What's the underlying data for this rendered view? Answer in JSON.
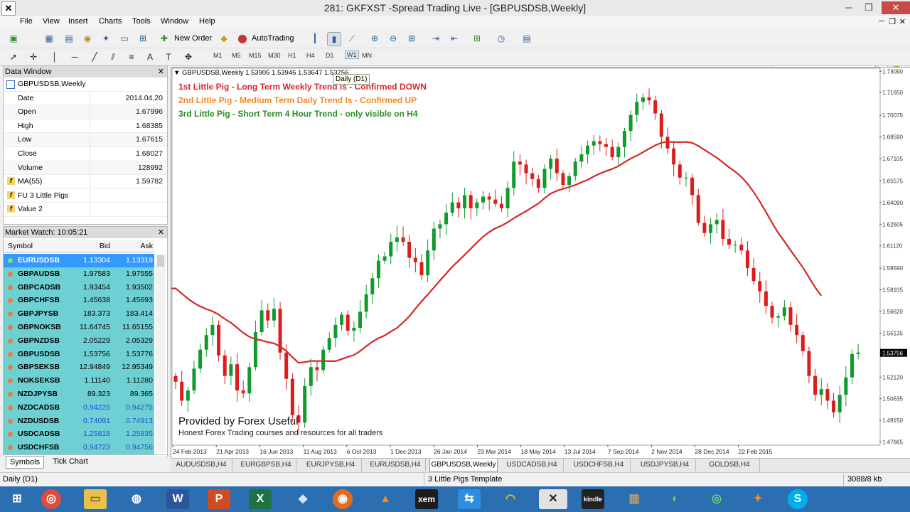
{
  "window": {
    "title": "281: GKFXST -Spread Trading Live - [GBPUSDSB,Weekly]"
  },
  "menu": [
    "File",
    "View",
    "Insert",
    "Charts",
    "Tools",
    "Window",
    "Help"
  ],
  "toolbar": {
    "new_order": "New Order",
    "autotrading": "AutoTrading"
  },
  "timeframes": [
    "M1",
    "M5",
    "M15",
    "M30",
    "H1",
    "H4",
    "D1",
    "W1",
    "MN"
  ],
  "tooltip": "Daily (D1)",
  "data_window": {
    "title": "Data Window",
    "symbol": "GBPUSDSB,Weekly",
    "rows": [
      {
        "label": "Date",
        "value": "2014.04.20"
      },
      {
        "label": "Open",
        "value": "1.67996"
      },
      {
        "label": "High",
        "value": "1.68385"
      },
      {
        "label": "Low",
        "value": "1.67615"
      },
      {
        "label": "Close",
        "value": "1.68027"
      },
      {
        "label": "Volume",
        "value": "128992"
      },
      {
        "label": "MA(55)",
        "value": "1.59782"
      },
      {
        "label": "FU 3 Little Pigs",
        "value": ""
      },
      {
        "label": "Value 2",
        "value": ""
      }
    ]
  },
  "market_watch": {
    "title": "Market Watch: 10:05:21",
    "headers": {
      "symbol": "Symbol",
      "bid": "Bid",
      "ask": "Ask"
    },
    "rows": [
      {
        "symbol": "EURUSDSB",
        "bid": "1.13304",
        "ask": "1.13319"
      },
      {
        "symbol": "GBPAUDSB",
        "bid": "1.97583",
        "ask": "1.97555"
      },
      {
        "symbol": "GBPCADSB",
        "bid": "1.93454",
        "ask": "1.93502"
      },
      {
        "symbol": "GBPCHFSB",
        "bid": "1.45638",
        "ask": "1.45693"
      },
      {
        "symbol": "GBPJPYSB",
        "bid": "183.373",
        "ask": "183.414"
      },
      {
        "symbol": "GBPNOKSB",
        "bid": "11.64745",
        "ask": "11.65155"
      },
      {
        "symbol": "GBPNZDSB",
        "bid": "2.05229",
        "ask": "2.05329"
      },
      {
        "symbol": "GBPUSDSB",
        "bid": "1.53756",
        "ask": "1.53776"
      },
      {
        "symbol": "GBPSEKSB",
        "bid": "12.94849",
        "ask": "12.95349"
      },
      {
        "symbol": "NOKSEKSB",
        "bid": "1.11140",
        "ask": "1.11280"
      },
      {
        "symbol": "NZDJPYSB",
        "bid": "89.323",
        "ask": "89.365"
      },
      {
        "symbol": "NZDCADSB",
        "bid": "0.94225",
        "ask": "0.94275"
      },
      {
        "symbol": "NZDUSDSB",
        "bid": "0.74091",
        "ask": "0.74913"
      },
      {
        "symbol": "USDCADSB",
        "bid": "1.25818",
        "ask": "1.25835"
      },
      {
        "symbol": "USDCHFSB",
        "bid": "0.94723",
        "ask": "0.94756"
      }
    ],
    "tabs": [
      "Symbols",
      "Tick Chart"
    ]
  },
  "chart": {
    "header": "GBPUSDSB,Weekly  1.53905 1.53946 1.53647 1.53756",
    "trend_lines": [
      {
        "text": "1st Little Pig - Long Term Weekly Trend is - Confirmed DOWN",
        "color": "#d9262b"
      },
      {
        "text": "2nd Little Pig - Medium Term Daily Trend Is - Confirmed UP",
        "color": "#f08a24"
      },
      {
        "text": "3rd Little Pig - Short Term 4 Hour Trend - only visible on H4",
        "color": "#2e8b2e"
      }
    ],
    "watermark": "Provided by Forex Useful",
    "subtitle": "Honest Forex Trading courses and resources for all traders",
    "current_price": "1.53756",
    "colors": {
      "bull": "#119b2d",
      "bear": "#dd1c1c",
      "ma": "#d42828"
    }
  },
  "chart_data": {
    "type": "candlestick",
    "x_labels": [
      "24 Feb 2013",
      "21 Apr 2013",
      "16 Jun 2013",
      "11 Aug 2013",
      "6 Oct 2013",
      "1 Dec 2013",
      "26 Jan 2014",
      "23 Mar 2014",
      "18 May 2014",
      "13 Jul 2014",
      "7 Sep 2014",
      "2 Nov 2014",
      "28 Dec 2014",
      "22 Feb 2015"
    ],
    "y_ticks": [
      "1.73090",
      "1.71650",
      "1.70075",
      "1.68590",
      "1.67105",
      "1.65575",
      "1.64090",
      "1.62605",
      "1.61120",
      "1.59590",
      "1.58105",
      "1.56620",
      "1.55135",
      "1.53756",
      "1.52120",
      "1.50635",
      "1.49150",
      "1.47665"
    ],
    "ylim": [
      1.4745,
      1.733
    ],
    "closes": [
      1.518,
      1.505,
      1.512,
      1.527,
      1.54,
      1.55,
      1.557,
      1.536,
      1.522,
      1.53,
      1.512,
      1.51,
      1.528,
      1.552,
      1.567,
      1.56,
      1.568,
      1.538,
      1.52,
      1.495,
      1.49,
      1.515,
      1.528,
      1.526,
      1.54,
      1.548,
      1.557,
      1.564,
      1.553,
      1.555,
      1.566,
      1.578,
      1.589,
      1.601,
      1.604,
      1.614,
      1.617,
      1.614,
      1.603,
      1.6,
      1.591,
      1.608,
      1.623,
      1.626,
      1.634,
      1.641,
      1.637,
      1.646,
      1.637,
      1.641,
      1.645,
      1.643,
      1.64,
      1.637,
      1.651,
      1.669,
      1.667,
      1.661,
      1.657,
      1.651,
      1.664,
      1.671,
      1.661,
      1.653,
      1.659,
      1.669,
      1.674,
      1.68,
      1.683,
      1.681,
      1.679,
      1.672,
      1.679,
      1.69,
      1.701,
      1.71,
      1.713,
      1.711,
      1.702,
      1.686,
      1.678,
      1.667,
      1.658,
      1.658,
      1.646,
      1.627,
      1.62,
      1.626,
      1.629,
      1.616,
      1.612,
      1.612,
      1.608,
      1.596,
      1.587,
      1.58,
      1.57,
      1.562,
      1.563,
      1.569,
      1.557,
      1.55,
      1.539,
      1.522,
      1.509,
      1.513,
      1.505,
      1.497,
      1.509,
      1.521,
      1.537,
      1.538
    ],
    "ma_label": "MA(55)"
  },
  "chart_tabs": [
    "AUDUSDSB,H4",
    "EURGBPSB,H4",
    "EURJPYSB,H4",
    "EURUSDSB,H4",
    "GBPUSDSB,Weekly",
    "USDCADSB,H4",
    "USDCHFSB,H4",
    "USDJPYSB,H4",
    "GOLDSB,H4"
  ],
  "active_chart_tab": "GBPUSDSB,Weekly",
  "status": {
    "left": "Daily (D1)",
    "template": "3 Little Pigs Template",
    "traffic": "3088/8 kb"
  },
  "taskbar": [
    "windows-start",
    "chrome",
    "file-explorer",
    "sniper",
    "word",
    "powerpoint",
    "excel",
    "dropbox",
    "firefox",
    "vlc",
    "xem",
    "teamviewer",
    "headphones",
    "metatrader",
    "kindle",
    "books",
    "evernote",
    "chrome-green",
    "avast",
    "skype"
  ]
}
